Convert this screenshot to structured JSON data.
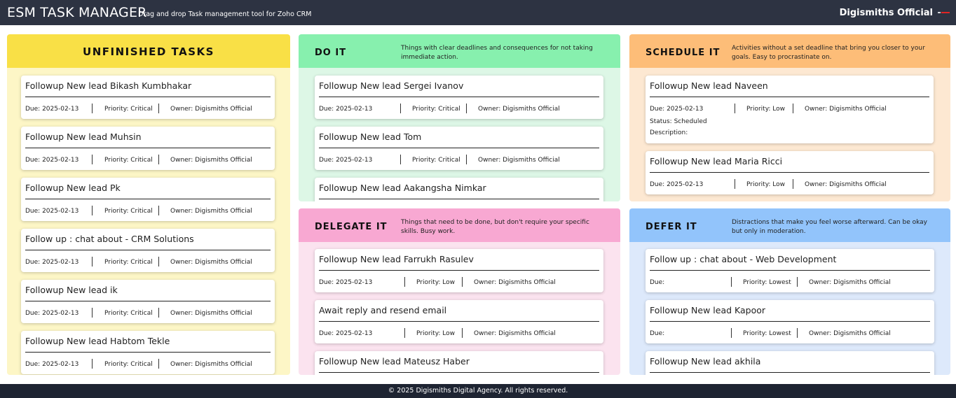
{
  "header": {
    "title": "ESM TASK MANAGER",
    "subtitle": "Drag and drop Task management tool for Zoho CRM",
    "org_name": "Digismiths Official"
  },
  "panels": {
    "unfinished": {
      "title": "UNFINISHED TASKS",
      "tasks": [
        {
          "title": "Followup New lead Bikash Kumbhakar",
          "due": "Due: 2025-02-13",
          "priority": "Priority: Critical",
          "owner": "Owner: Digismiths Official"
        },
        {
          "title": "Followup New lead Muhsin",
          "due": "Due: 2025-02-13",
          "priority": "Priority: Critical",
          "owner": "Owner: Digismiths Official"
        },
        {
          "title": "Followup New lead Pk",
          "due": "Due: 2025-02-13",
          "priority": "Priority: Critical",
          "owner": "Owner: Digismiths Official"
        },
        {
          "title": "Follow up : chat about - CRM Solutions",
          "due": "Due: 2025-02-13",
          "priority": "Priority: Critical",
          "owner": "Owner: Digismiths Official"
        },
        {
          "title": "Followup New lead ik",
          "due": "Due: 2025-02-13",
          "priority": "Priority: Critical",
          "owner": "Owner: Digismiths Official"
        },
        {
          "title": "Followup New lead Habtom Tekle",
          "due": "Due: 2025-02-13",
          "priority": "Priority: Critical",
          "owner": "Owner: Digismiths Official"
        }
      ]
    },
    "do_it": {
      "title": "DO IT",
      "description": "Things with clear deadlines and consequences for not taking immediate action.",
      "tasks": [
        {
          "title": "Followup New lead Sergei Ivanov",
          "due": "Due: 2025-02-13",
          "priority": "Priority: Critical",
          "owner": "Owner: Digismiths Official"
        },
        {
          "title": "Followup New lead Tom",
          "due": "Due: 2025-02-13",
          "priority": "Priority: Critical",
          "owner": "Owner: Digismiths Official"
        },
        {
          "title": "Followup New lead Aakangsha Nimkar"
        }
      ]
    },
    "delegate_it": {
      "title": "DELEGATE IT",
      "description": "Things that need to be done, but don't require your specific skills. Busy work.",
      "tasks": [
        {
          "title": "Followup New lead Farrukh Rasulev",
          "due": "Due: 2025-02-13",
          "priority": "Priority:  Low",
          "owner": "Owner: Digismiths Official"
        },
        {
          "title": "Await reply and resend email",
          "due": "Due: 2025-02-13",
          "priority": "Priority:  Low",
          "owner": "Owner: Digismiths Official"
        },
        {
          "title": "Followup New lead Mateusz Haber"
        }
      ]
    },
    "schedule_it": {
      "title": "SCHEDULE IT",
      "description": "Activities without a set deadline that bring you closer to your goals. Easy to procrastinate on.",
      "tasks": [
        {
          "title": "Followup New lead Naveen",
          "due": "Due: 2025-02-13",
          "priority": "Priority:  Low",
          "owner": "Owner: Digismiths Official",
          "status": "Status: Scheduled",
          "description": "Description:"
        },
        {
          "title": "Followup New lead Maria Ricci",
          "due": "Due: 2025-02-13",
          "priority": "Priority:  Low",
          "owner": "Owner: Digismiths Official"
        }
      ]
    },
    "defer_it": {
      "title": "DEFER IT",
      "description": "Distractions that make you feel worse afterward. Can be okay but only in moderation.",
      "tasks": [
        {
          "title": "Follow up : chat about - Web Development",
          "due": "Due:",
          "priority": "Priority:  Lowest",
          "owner": "Owner: Digismiths Official"
        },
        {
          "title": "Followup New lead Kapoor",
          "due": "Due:",
          "priority": "Priority:  Lowest",
          "owner": "Owner: Digismiths Official"
        },
        {
          "title": "Followup New lead akhila"
        }
      ]
    }
  },
  "footer": {
    "copyright": "© 2025 Digismiths Digital Agency. All rights reserved."
  },
  "colors": {
    "topbar": "#2d3342",
    "unfinished": "#f9e046",
    "do_it": "#87f0ae",
    "delegate_it": "#f8a8d2",
    "schedule_it": "#fdbd78",
    "defer_it": "#92c4fb"
  }
}
